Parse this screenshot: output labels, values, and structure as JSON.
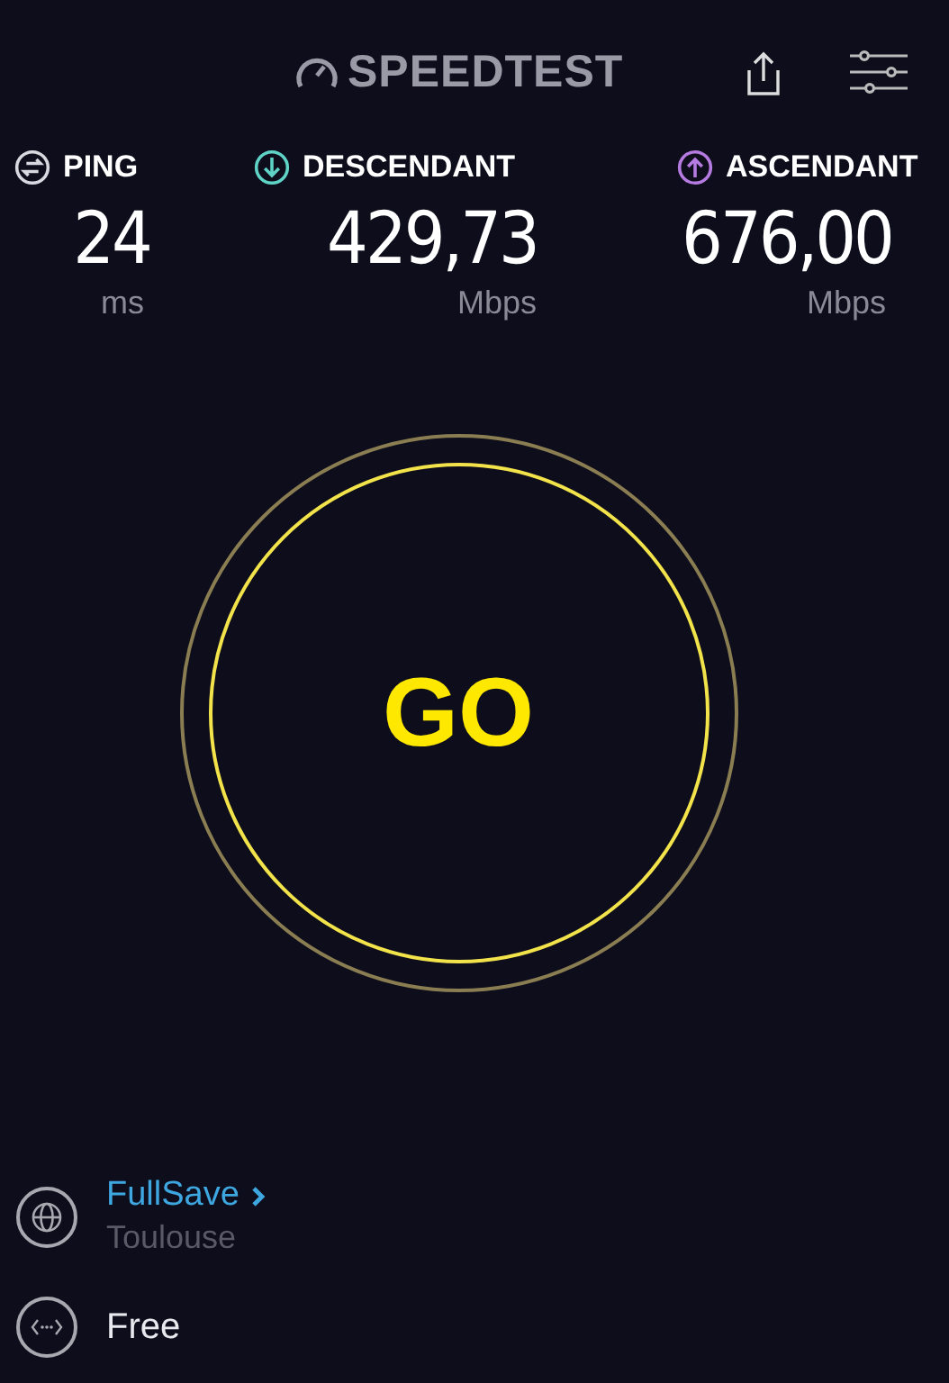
{
  "header": {
    "logo": "SPEEDTEST"
  },
  "metrics": [
    {
      "kind": "ping",
      "label": "PING",
      "value": "24",
      "unit": "ms",
      "color": "#d8d8e0"
    },
    {
      "kind": "download",
      "label": "DESCENDANT",
      "value": "429,73",
      "unit": "Mbps",
      "color": "#5fd3c6"
    },
    {
      "kind": "upload",
      "label": "ASCENDANT",
      "value": "676,00",
      "unit": "Mbps",
      "color": "#b57be0"
    }
  ],
  "go_button": {
    "label": "GO"
  },
  "connections": [
    {
      "kind": "server",
      "name": "FullSave",
      "location": "Toulouse"
    },
    {
      "kind": "provider",
      "name": "Free"
    }
  ]
}
